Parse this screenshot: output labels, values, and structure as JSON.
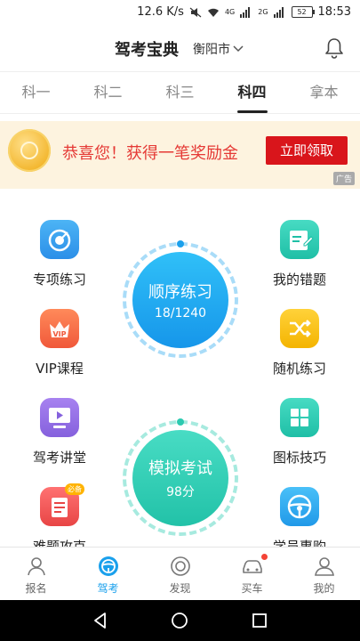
{
  "status_bar": {
    "net_speed": "12.6 K/s",
    "signal_1": "4G",
    "signal_2": "2G",
    "battery": "52",
    "time": "18:53"
  },
  "header": {
    "title": "驾考宝典",
    "city": "衡阳市",
    "bell_icon": "bell-icon"
  },
  "tabs": [
    {
      "label": "科一"
    },
    {
      "label": "科二"
    },
    {
      "label": "科三"
    },
    {
      "label": "科四"
    },
    {
      "label": "拿本"
    }
  ],
  "active_tab": "科四",
  "ad": {
    "message": "恭喜您！获得一笔奖励金",
    "button": "立即领取",
    "tag": "广告"
  },
  "features": {
    "special_practice": "专项练习",
    "vip_course": "VIP课程",
    "vip_badge": "VIP",
    "lecture_hall": "驾考讲堂",
    "hard_questions": "难题攻克",
    "hard_badge": "必备",
    "my_mistakes": "我的错题",
    "random_practice": "随机练习",
    "icon_tips": "图标技巧",
    "student_buy": "学员惠购"
  },
  "sequential": {
    "title": "顺序练习",
    "progress": "18/1240"
  },
  "mock_exam": {
    "title": "模拟考试",
    "score": "98分"
  },
  "bottom_nav": [
    {
      "label": "报名",
      "icon": "register-icon"
    },
    {
      "label": "驾考",
      "icon": "steering-wheel-icon"
    },
    {
      "label": "发现",
      "icon": "discover-icon"
    },
    {
      "label": "买车",
      "icon": "car-icon"
    },
    {
      "label": "我的",
      "icon": "profile-icon"
    }
  ],
  "colors": {
    "accent_blue": "#1aa0ec",
    "accent_teal": "#2ccab0",
    "ad_red": "#d9151b"
  }
}
